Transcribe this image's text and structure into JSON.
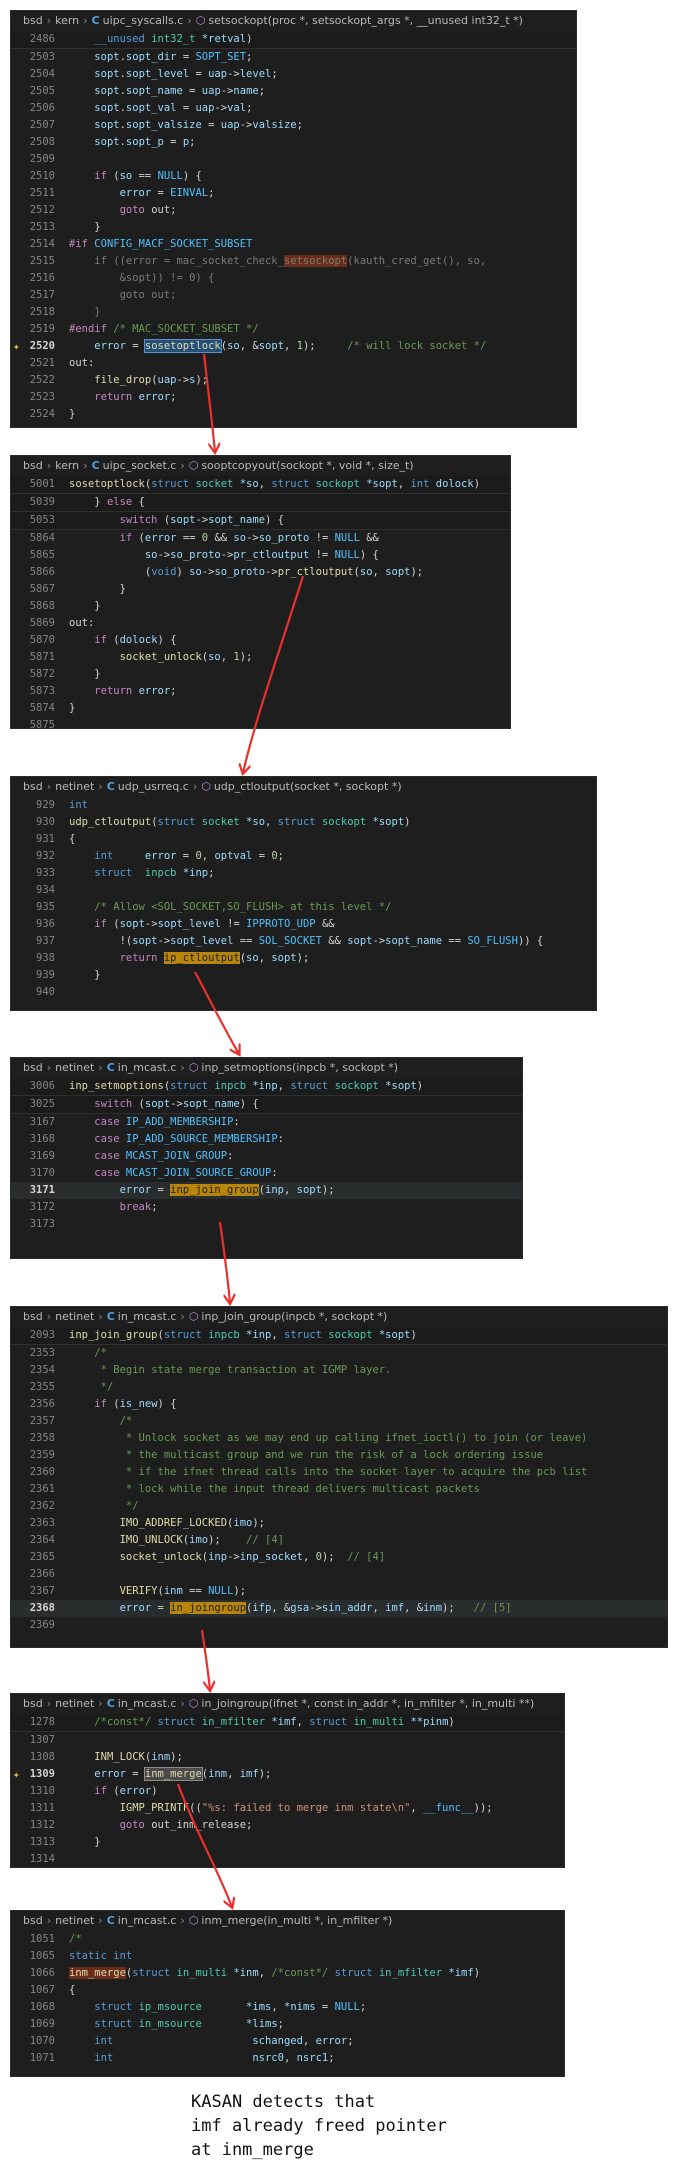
{
  "panels": [
    {
      "crumb": [
        "bsd",
        "kern",
        "uipc_syscalls.c",
        "setsockopt(proc *, setsockopt_args *, __unused int32_t *)"
      ],
      "lines": [
        [
          "2486",
          "    <span class=\"kw\">__unused</span> <span class=\"ty\">int32_t</span> <span class=\"vr\">*retval</span>)",
          "sticky"
        ],
        [
          "2503",
          "    <span class=\"vr\">sopt</span>.<span class=\"vr\">sopt_dir</span> = <span class=\"cst\">SOPT_SET</span>;",
          ""
        ],
        [
          "2504",
          "    <span class=\"vr\">sopt</span>.<span class=\"vr\">sopt_level</span> = <span class=\"vr\">uap</span>-><span class=\"vr\">level</span>;",
          ""
        ],
        [
          "2505",
          "    <span class=\"vr\">sopt</span>.<span class=\"vr\">sopt_name</span> = <span class=\"vr\">uap</span>-><span class=\"vr\">name</span>;",
          ""
        ],
        [
          "2506",
          "    <span class=\"vr\">sopt</span>.<span class=\"vr\">sopt_val</span> = <span class=\"vr\">uap</span>-><span class=\"vr\">val</span>;",
          ""
        ],
        [
          "2507",
          "    <span class=\"vr\">sopt</span>.<span class=\"vr\">sopt_valsize</span> = <span class=\"vr\">uap</span>-><span class=\"vr\">valsize</span>;",
          ""
        ],
        [
          "2508",
          "    <span class=\"vr\">sopt</span>.<span class=\"vr\">sopt_p</span> = <span class=\"vr\">p</span>;",
          ""
        ],
        [
          "2509",
          "",
          ""
        ],
        [
          "2510",
          "    <span class=\"ctl\">if</span> (<span class=\"vr\">so</span> == <span class=\"cst\">NULL</span>) {",
          ""
        ],
        [
          "2511",
          "        <span class=\"vr\">error</span> = <span class=\"cst\">EINVAL</span>;",
          ""
        ],
        [
          "2512",
          "        <span class=\"ctl\">goto</span> out;",
          ""
        ],
        [
          "2513",
          "    }",
          ""
        ],
        [
          "2514",
          "<span class=\"pp\">#if</span> <span class=\"cst\">CONFIG_MACF_SOCKET_SUBSET</span>",
          ""
        ],
        [
          "2515",
          "    <span class=\"dim\">if ((error = mac_socket_check_<span class=\"mark-r\">setsockopt</span>(kauth_cred_get(), so,</span>",
          ""
        ],
        [
          "2516",
          "        <span class=\"dim\">&amp;sopt)) != 0) {</span>",
          ""
        ],
        [
          "2517",
          "        <span class=\"dim\">goto out;</span>",
          ""
        ],
        [
          "2518",
          "    <span class=\"dim\">}</span>",
          ""
        ],
        [
          "2519",
          "<span class=\"pp\">#endif</span> <span class=\"cm\">/* MAC_SOCKET_SUBSET */</span>",
          ""
        ],
        [
          "2520",
          "    <span class=\"vr\">error</span> = <span class=\"fn mark-s\">sosetoptlock</span>(<span class=\"vr\">so</span>, &amp;<span class=\"vr\">sopt</span>, <span class=\"nm\">1</span>);     <span class=\"cm\">/* will lock socket */</span>",
          "cur hint"
        ],
        [
          "2521",
          "out:",
          ""
        ],
        [
          "2522",
          "    <span class=\"fn\">file_drop</span>(<span class=\"vr\">uap</span>-><span class=\"vr\">s</span>);",
          ""
        ],
        [
          "2523",
          "    <span class=\"ctl\">return</span> <span class=\"vr\">error</span>;",
          ""
        ],
        [
          "2524",
          "}",
          ""
        ]
      ]
    },
    {
      "crumb": [
        "bsd",
        "kern",
        "uipc_socket.c",
        "sooptcopyout(sockopt *, void *, size_t)"
      ],
      "lines": [
        [
          "5001",
          "<span class=\"fn\">sosetoptlock</span>(<span class=\"kw\">struct</span> <span class=\"ty\">socket</span> <span class=\"vr\">*so</span>, <span class=\"kw\">struct</span> <span class=\"ty\">sockopt</span> <span class=\"vr\">*sopt</span>, <span class=\"kw\">int</span> <span class=\"vr\">dolock</span>)",
          "sticky"
        ],
        [
          "5039",
          "    } <span class=\"ctl\">else</span> {",
          "sticky"
        ],
        [
          "5053",
          "        <span class=\"ctl\">switch</span> (<span class=\"vr\">sopt</span>-><span class=\"vr\">sopt_name</span>) {",
          "sticky"
        ],
        [
          "5864",
          "        <span class=\"ctl\">if</span> (<span class=\"vr\">error</span> == <span class=\"nm\">0</span> &amp;&amp; <span class=\"vr\">so</span>-><span class=\"vr\">so_proto</span> != <span class=\"cst\">NULL</span> &amp;&amp;",
          ""
        ],
        [
          "5865",
          "            <span class=\"vr\">so</span>-><span class=\"vr\">so_proto</span>-><span class=\"vr\">pr_ctloutput</span> != <span class=\"cst\">NULL</span>) {",
          ""
        ],
        [
          "5866",
          "            (<span class=\"kw\">void</span>) <span class=\"vr\">so</span>-><span class=\"vr\">so_proto</span>-><span class=\"fn\">pr_ctloutput</span>(<span class=\"vr\">so</span>, <span class=\"vr\">sopt</span>);",
          ""
        ],
        [
          "5867",
          "        }",
          ""
        ],
        [
          "5868",
          "    }",
          ""
        ],
        [
          "5869",
          "out:",
          ""
        ],
        [
          "5870",
          "    <span class=\"ctl\">if</span> (<span class=\"vr\">dolock</span>) {",
          ""
        ],
        [
          "5871",
          "        <span class=\"fn\">socket_unlock</span>(<span class=\"vr\">so</span>, <span class=\"nm\">1</span>);",
          ""
        ],
        [
          "5872",
          "    }",
          ""
        ],
        [
          "5873",
          "    <span class=\"ctl\">return</span> <span class=\"vr\">error</span>;",
          ""
        ],
        [
          "5874",
          "}",
          ""
        ],
        [
          "5875",
          "",
          ""
        ]
      ]
    },
    {
      "crumb": [
        "bsd",
        "netinet",
        "udp_usrreq.c",
        "udp_ctloutput(socket *, sockopt *)"
      ],
      "lines": [
        [
          "929",
          "<span class=\"kw\">int</span>",
          ""
        ],
        [
          "930",
          "<span class=\"fn\">udp_ctloutput</span>(<span class=\"kw\">struct</span> <span class=\"ty\">socket</span> <span class=\"vr\">*so</span>, <span class=\"kw\">struct</span> <span class=\"ty\">sockopt</span> <span class=\"vr\">*sopt</span>)",
          ""
        ],
        [
          "931",
          "{",
          ""
        ],
        [
          "932",
          "    <span class=\"kw\">int</span>     <span class=\"vr\">error</span> = <span class=\"nm\">0</span>, <span class=\"vr\">optval</span> = <span class=\"nm\">0</span>;",
          ""
        ],
        [
          "933",
          "    <span class=\"kw\">struct</span>  <span class=\"ty\">inpcb</span> <span class=\"vr\">*inp</span>;",
          ""
        ],
        [
          "934",
          "",
          ""
        ],
        [
          "935",
          "    <span class=\"cm\">/* Allow &lt;SOL_SOCKET,SO_FLUSH&gt; at this level */</span>",
          ""
        ],
        [
          "936",
          "    <span class=\"ctl\">if</span> (<span class=\"vr\">sopt</span>-><span class=\"vr\">sopt_level</span> != <span class=\"cst\">IPPROTO_UDP</span> &amp;&amp;",
          ""
        ],
        [
          "937",
          "        !(<span class=\"vr\">sopt</span>-><span class=\"vr\">sopt_level</span> == <span class=\"cst\">SOL_SOCKET</span> &amp;&amp; <span class=\"vr\">sopt</span>-><span class=\"vr\">sopt_name</span> == <span class=\"cst\">SO_FLUSH</span>)) {",
          ""
        ],
        [
          "938",
          "        <span class=\"ctl\">return</span> <span class=\"fn mark-o\">ip_ctloutput</span>(<span class=\"vr\">so</span>, <span class=\"vr\">sopt</span>);",
          ""
        ],
        [
          "939",
          "    }",
          ""
        ],
        [
          "940",
          "",
          ""
        ]
      ]
    },
    {
      "crumb": [
        "bsd",
        "netinet",
        "in_mcast.c",
        "inp_setmoptions(inpcb *, sockopt *)"
      ],
      "lines": [
        [
          "3006",
          "<span class=\"fn\">inp_setmoptions</span>(<span class=\"kw\">struct</span> <span class=\"ty\">inpcb</span> <span class=\"vr\">*inp</span>, <span class=\"kw\">struct</span> <span class=\"ty\">sockopt</span> <span class=\"vr\">*sopt</span>)",
          "sticky"
        ],
        [
          "3025",
          "    <span class=\"ctl\">switch</span> (<span class=\"vr\">sopt</span>-><span class=\"vr\">sopt_name</span>) {",
          "sticky"
        ],
        [
          "3167",
          "    <span class=\"ctl\">case</span> <span class=\"cst\">IP_ADD_MEMBERSHIP</span>:",
          ""
        ],
        [
          "3168",
          "    <span class=\"ctl\">case</span> <span class=\"cst\">IP_ADD_SOURCE_MEMBERSHIP</span>:",
          ""
        ],
        [
          "3169",
          "    <span class=\"ctl\">case</span> <span class=\"cst\">MCAST_JOIN_GROUP</span>:",
          ""
        ],
        [
          "3170",
          "    <span class=\"ctl\">case</span> <span class=\"cst\">MCAST_JOIN_SOURCE_GROUP</span>:",
          ""
        ],
        [
          "3171",
          "        <span class=\"vr\">error</span> = <span class=\"fn mark-o\">inp_join_group</span>(<span class=\"vr\">inp</span>, <span class=\"vr\">sopt</span>);",
          "cur hl"
        ],
        [
          "3172",
          "        <span class=\"ctl\">break</span>;",
          ""
        ],
        [
          "3173",
          "",
          ""
        ]
      ]
    },
    {
      "crumb": [
        "bsd",
        "netinet",
        "in_mcast.c",
        "inp_join_group(inpcb *, sockopt *)"
      ],
      "lines": [
        [
          "2093",
          "<span class=\"fn\">inp_join_group</span>(<span class=\"kw\">struct</span> <span class=\"ty\">inpcb</span> <span class=\"vr\">*inp</span>, <span class=\"kw\">struct</span> <span class=\"ty\">sockopt</span> <span class=\"vr\">*sopt</span>)",
          "sticky"
        ],
        [
          "2353",
          "    <span class=\"cm\">/*</span>",
          ""
        ],
        [
          "2354",
          "    <span class=\"cm\"> * Begin state merge transaction at IGMP layer.</span>",
          ""
        ],
        [
          "2355",
          "    <span class=\"cm\"> */</span>",
          ""
        ],
        [
          "2356",
          "    <span class=\"ctl\">if</span> (<span class=\"vr\">is_new</span>) {",
          ""
        ],
        [
          "2357",
          "        <span class=\"cm\">/*</span>",
          ""
        ],
        [
          "2358",
          "        <span class=\"cm\"> * Unlock socket as we may end up calling ifnet_ioctl() to join (or leave)</span>",
          ""
        ],
        [
          "2359",
          "        <span class=\"cm\"> * the multicast group and we run the risk of a lock ordering issue</span>",
          ""
        ],
        [
          "2360",
          "        <span class=\"cm\"> * if the ifnet thread calls into the socket layer to acquire the pcb list</span>",
          ""
        ],
        [
          "2361",
          "        <span class=\"cm\"> * lock while the input thread delivers multicast packets</span>",
          ""
        ],
        [
          "2362",
          "        <span class=\"cm\"> */</span>",
          ""
        ],
        [
          "2363",
          "        <span class=\"fn\">IMO_ADDREF_LOCKED</span>(<span class=\"vr\">imo</span>);",
          ""
        ],
        [
          "2364",
          "        <span class=\"fn\">IMO_UNLOCK</span>(<span class=\"vr\">imo</span>);    <span class=\"cm\">// [4]</span>",
          ""
        ],
        [
          "2365",
          "        <span class=\"fn\">socket_unlock</span>(<span class=\"vr\">inp</span>-><span class=\"vr\">inp_socket</span>, <span class=\"nm\">0</span>);  <span class=\"cm\">// [4]</span>",
          ""
        ],
        [
          "2366",
          "",
          ""
        ],
        [
          "2367",
          "        <span class=\"fn\">VERIFY</span>(<span class=\"vr\">inm</span> == <span class=\"cst\">NULL</span>);",
          ""
        ],
        [
          "2368",
          "        <span class=\"vr\">error</span> = <span class=\"fn mark-o\">in_joingroup</span>(<span class=\"vr\">ifp</span>, &amp;<span class=\"vr\">gsa</span>-><span class=\"vr\">sin_addr</span>, <span class=\"vr\">imf</span>, &amp;<span class=\"vr\">inm</span>);   <span class=\"cm\">// [5]</span>",
          "cur hl"
        ],
        [
          "2369",
          "",
          ""
        ]
      ]
    },
    {
      "crumb": [
        "bsd",
        "netinet",
        "in_mcast.c",
        "in_joingroup(ifnet *, const in_addr *, in_mfilter *, in_multi **)"
      ],
      "lines": [
        [
          "1278",
          "    <span class=\"cm\">/*const*/</span> <span class=\"kw\">struct</span> <span class=\"ty\">in_mfilter</span> <span class=\"vr\">*imf</span>, <span class=\"kw\">struct</span> <span class=\"ty\">in_multi</span> <span class=\"vr\">**pinm</span>)",
          "sticky"
        ],
        [
          "1307",
          "",
          ""
        ],
        [
          "1308",
          "    <span class=\"fn\">INM_LOCK</span>(<span class=\"vr\">inm</span>);",
          ""
        ],
        [
          "1309",
          "    <span class=\"vr\">error</span> = <span class=\"fn mark-g\">inm_merge</span>(<span class=\"vr\">inm</span>, <span class=\"vr\">imf</span>);",
          "cur hint"
        ],
        [
          "1310",
          "    <span class=\"ctl\">if</span> (<span class=\"vr\">error</span>)",
          ""
        ],
        [
          "1311",
          "        <span class=\"fn\">IGMP_PRINTF</span>((<span class=\"st\">\"%s: failed to merge inm state\\n\"</span>, <span class=\"cst\">__func__</span>));",
          ""
        ],
        [
          "1312",
          "        <span class=\"ctl\">goto</span> out_inm_release;",
          ""
        ],
        [
          "1313",
          "    }",
          ""
        ],
        [
          "1314",
          "",
          ""
        ]
      ]
    },
    {
      "crumb": [
        "bsd",
        "netinet",
        "in_mcast.c",
        "inm_merge(in_multi *, in_mfilter *)"
      ],
      "lines": [
        [
          "1051",
          "<span class=\"cm\">/*</span>",
          ""
        ],
        [
          "1065",
          "<span class=\"kw\">static</span> <span class=\"kw\">int</span>",
          ""
        ],
        [
          "1066",
          "<span class=\"fn mark-r\">inm_merge</span>(<span class=\"kw\">struct</span> <span class=\"ty\">in_multi</span> <span class=\"vr\">*inm</span>, <span class=\"cm\">/*const*/</span> <span class=\"kw\">struct</span> <span class=\"ty\">in_mfilter</span> <span class=\"vr\">*imf</span>)",
          ""
        ],
        [
          "1067",
          "{",
          ""
        ],
        [
          "1068",
          "    <span class=\"kw\">struct</span> <span class=\"ty\">ip_msource</span>       <span class=\"vr\">*ims</span>, <span class=\"vr\">*nims</span> = <span class=\"cst\">NULL</span>;",
          ""
        ],
        [
          "1069",
          "    <span class=\"kw\">struct</span> <span class=\"ty\">in_msource</span>       <span class=\"vr\">*lims</span>;",
          ""
        ],
        [
          "1070",
          "    <span class=\"kw\">int</span>                      <span class=\"vr\">schanged</span>, <span class=\"vr\">error</span>;",
          ""
        ],
        [
          "1071",
          "    <span class=\"kw\">int</span>                      <span class=\"vr\">nsrc0</span>, <span class=\"vr\">nsrc1</span>;",
          ""
        ]
      ]
    }
  ],
  "caption": [
    "KASAN detects that",
    "imf already freed pointer",
    "at inm_merge"
  ],
  "colors": {
    "arrow": "#e8312d",
    "editor_bg": "#1e1e1e",
    "highlight": "#b8860b"
  },
  "icons": {
    "file": "c-icon",
    "function": "function-cube-icon",
    "hint": "sparkle-icon",
    "separator": "chevron-right-icon"
  }
}
